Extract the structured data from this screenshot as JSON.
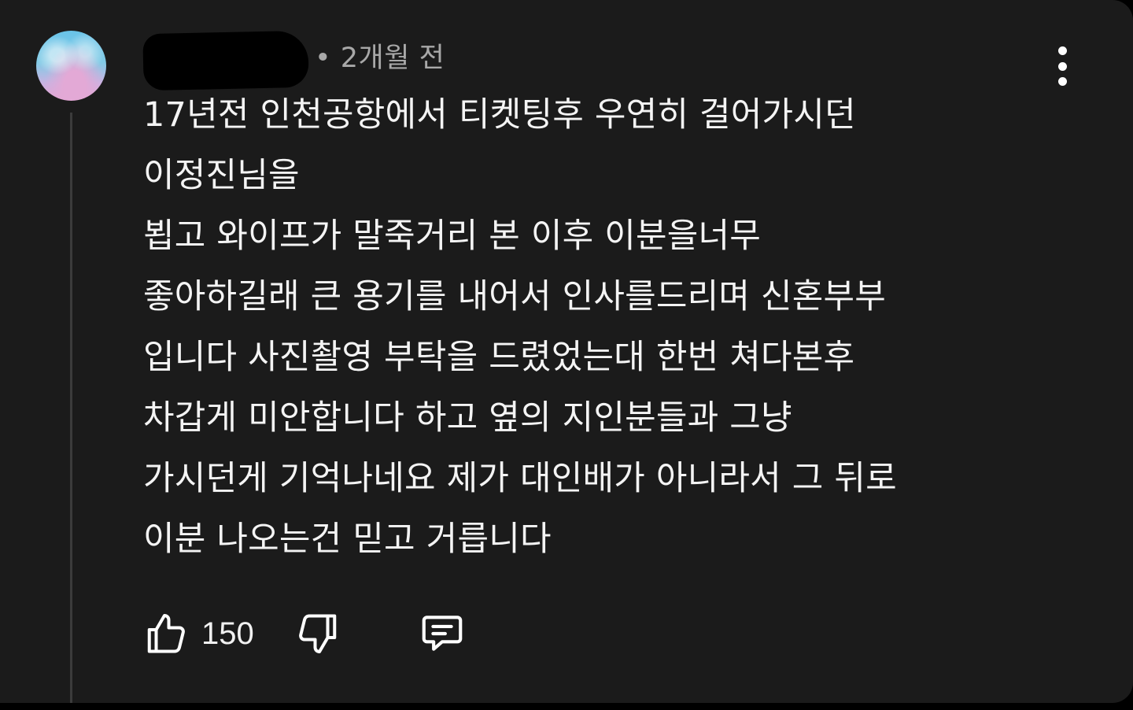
{
  "comment": {
    "author_hidden": true,
    "meta": "• 2개월 전",
    "lines": [
      "17년전 인천공항에서 티켓팅후 우연히 걸어가시던",
      "이정진님을",
      "뵙고 와이프가 말죽거리 본 이후 이분을너무",
      "좋아하길래 큰 용기를 내어서 인사를드리며 신혼부부",
      "입니다 사진촬영 부탁을 드렸었는대 한번 쳐다본후",
      "차갑게 미안합니다 하고 옆의 지인분들과 그냥",
      "가시던게 기억나네요 제가 대인배가 아니라서 그 뒤로",
      "이분 나오는건 믿고 거릅니다"
    ],
    "like_count": "150"
  },
  "icons": {
    "avatar": "avatar-image",
    "more": "more-vertical-icon",
    "like": "thumbs-up-icon",
    "dislike": "thumbs-down-icon",
    "reply": "reply-comment-icon"
  },
  "colors": {
    "background": "#1b1b1b",
    "text": "#f1f1f1",
    "meta": "#a8a8a8"
  }
}
